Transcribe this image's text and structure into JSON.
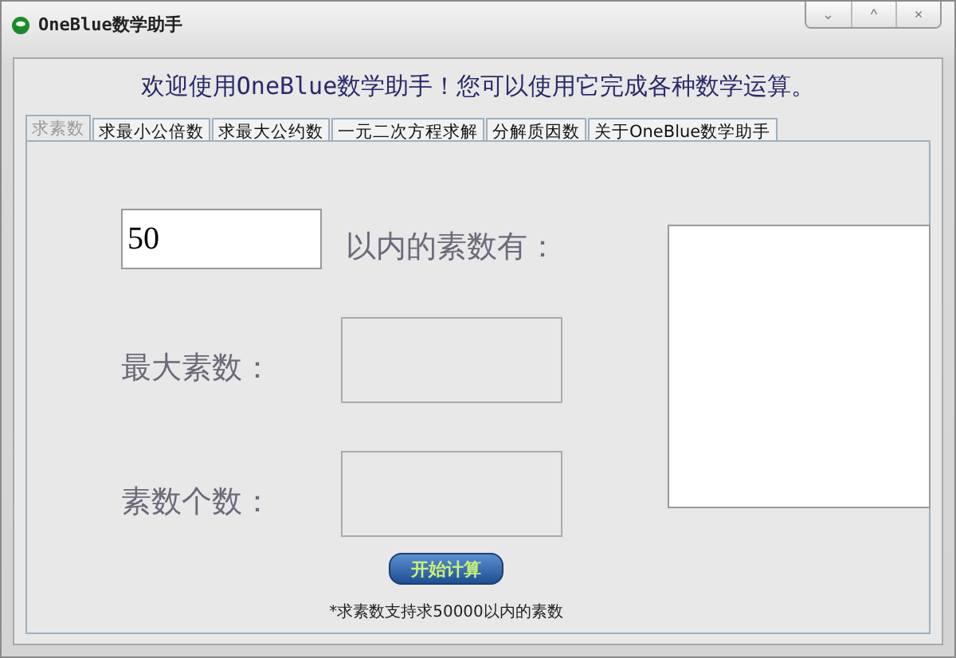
{
  "window": {
    "title": "OneBlue数学助手"
  },
  "window_controls": [
    "⌄",
    "^",
    "×"
  ],
  "welcome": "欢迎使用OneBlue数学助手！您可以使用它完成各种数学运算。",
  "tabs": [
    {
      "label": "求素数",
      "selected": true
    },
    {
      "label": "求最小公倍数",
      "selected": false
    },
    {
      "label": "求最大公约数",
      "selected": false
    },
    {
      "label": "一元二次方程求解",
      "selected": false
    },
    {
      "label": "分解质因数",
      "selected": false
    },
    {
      "label": "关于OneBlue数学助手",
      "selected": false
    }
  ],
  "limit_input": {
    "value": "50"
  },
  "limit_label": "以内的素数有：",
  "max_prime_label": "最大素数：",
  "count_label": "素数个数：",
  "start_button": "开始计算",
  "note": "*求素数支持求50000以内的素数"
}
